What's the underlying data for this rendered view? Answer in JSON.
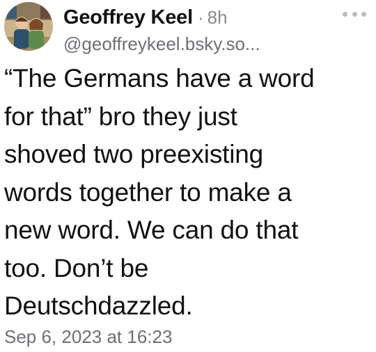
{
  "post": {
    "author": {
      "display_name": "Geoffrey Keel",
      "separator": "·",
      "relative_time": "8h",
      "handle": "@geoffreykeel.bsky.so..."
    },
    "body_lines": [
      "“The Germans have a word",
      "for that” bro they just",
      "shoved two preexisting",
      "words together to make a",
      "new word. We can do that",
      "too. Don’t be",
      "Deutschdazzled."
    ],
    "timestamp": "Sep 6, 2023 at 16:23",
    "icons": {
      "more": "more-horizontal-icon",
      "avatar": "cartoon-couple-avatar"
    }
  }
}
